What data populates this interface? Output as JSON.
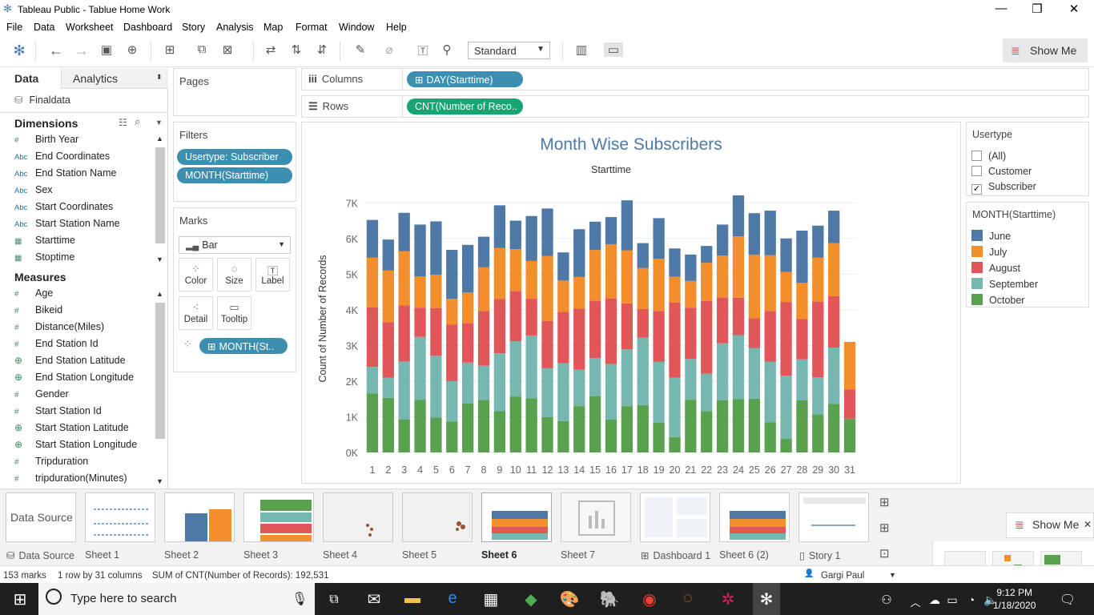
{
  "app": {
    "title": "Tableau Public - Tablue Home Work"
  },
  "menu": [
    "File",
    "Data",
    "Worksheet",
    "Dashboard",
    "Story",
    "Analysis",
    "Map",
    "Format",
    "Window",
    "Help"
  ],
  "toolbar": {
    "fit_value": "Standard",
    "show_me": "Show Me"
  },
  "data_pane": {
    "tab_data": "Data",
    "tab_analytics": "Analytics",
    "datasource": "Finaldata",
    "dimensions_header": "Dimensions",
    "dimensions": [
      {
        "type": "#",
        "name": "Birth Year"
      },
      {
        "type": "Abc",
        "name": "End Coordinates"
      },
      {
        "type": "Abc",
        "name": "End Station Name"
      },
      {
        "type": "Abc",
        "name": "Sex"
      },
      {
        "type": "Abc",
        "name": "Start Coordinates"
      },
      {
        "type": "Abc",
        "name": "Start Station Name"
      },
      {
        "type": "date",
        "name": "Starttime"
      },
      {
        "type": "date",
        "name": "Stoptime"
      }
    ],
    "measures_header": "Measures",
    "measures": [
      {
        "type": "#",
        "name": "Age"
      },
      {
        "type": "#",
        "name": "Bikeid"
      },
      {
        "type": "#",
        "name": "Distance(Miles)"
      },
      {
        "type": "#",
        "name": "End Station Id"
      },
      {
        "type": "geo",
        "name": "End Station Latitude"
      },
      {
        "type": "geo",
        "name": "End Station Longitude"
      },
      {
        "type": "#",
        "name": "Gender"
      },
      {
        "type": "#",
        "name": "Start Station Id"
      },
      {
        "type": "geo",
        "name": "Start Station Latitude"
      },
      {
        "type": "geo",
        "name": "Start Station Longitude"
      },
      {
        "type": "#",
        "name": "Tripduration"
      },
      {
        "type": "#",
        "name": "tripduration(Minutes)"
      }
    ]
  },
  "cards": {
    "pages": "Pages",
    "filters": "Filters",
    "filter_pills": [
      "Usertype: Subscriber",
      "MONTH(Starttime)"
    ],
    "marks": "Marks",
    "mark_type": "Bar",
    "mark_buttons": [
      "Color",
      "Size",
      "Label",
      "Detail",
      "Tooltip"
    ],
    "marks_pill": "MONTH(St.."
  },
  "shelves": {
    "columns_label": "Columns",
    "columns_pill": "DAY(Starttime)",
    "rows_label": "Rows",
    "rows_pill": "CNT(Number of Reco.."
  },
  "legends": {
    "usertype_title": "Usertype",
    "usertype_items": [
      {
        "label": "(All)",
        "checked": false
      },
      {
        "label": "Customer",
        "checked": false
      },
      {
        "label": "Subscriber",
        "checked": true
      }
    ],
    "month_title": "MONTH(Starttime)",
    "month_items": [
      {
        "label": "June",
        "color": "#4e79a7"
      },
      {
        "label": "July",
        "color": "#f28e2b"
      },
      {
        "label": "August",
        "color": "#e15759"
      },
      {
        "label": "September",
        "color": "#76b7b2"
      },
      {
        "label": "October",
        "color": "#59a14f"
      }
    ]
  },
  "chart_data": {
    "type": "bar",
    "stacked": true,
    "title": "Month Wise Subscribers",
    "xlabel": "Starttime",
    "ylabel": "Count of Number of Records",
    "ylim": [
      0,
      7500
    ],
    "yticks": [
      0,
      1000,
      2000,
      3000,
      4000,
      5000,
      6000,
      7000
    ],
    "ytick_labels": [
      "0K",
      "1K",
      "2K",
      "3K",
      "4K",
      "5K",
      "6K",
      "7K"
    ],
    "categories": [
      "1",
      "2",
      "3",
      "4",
      "5",
      "6",
      "7",
      "8",
      "9",
      "10",
      "11",
      "12",
      "13",
      "14",
      "15",
      "16",
      "17",
      "18",
      "19",
      "20",
      "21",
      "22",
      "23",
      "24",
      "25",
      "26",
      "27",
      "28",
      "29",
      "30",
      "31"
    ],
    "series": [
      {
        "name": "October",
        "color": "#59a14f",
        "values": [
          1650,
          1530,
          930,
          1480,
          980,
          870,
          1370,
          1470,
          1160,
          1570,
          1520,
          990,
          880,
          1300,
          1580,
          920,
          1300,
          1330,
          830,
          430,
          1480,
          1160,
          1460,
          1500,
          1510,
          850,
          380,
          1460,
          1070,
          1360,
          950
        ]
      },
      {
        "name": "September",
        "color": "#76b7b2",
        "values": [
          750,
          570,
          1620,
          1760,
          1730,
          1130,
          1150,
          960,
          1620,
          1550,
          1760,
          1370,
          1620,
          1020,
          1070,
          1560,
          1590,
          1890,
          1710,
          1670,
          1140,
          1050,
          1600,
          1790,
          1420,
          1690,
          1770,
          1150,
          1040,
          1580,
          0
        ]
      },
      {
        "name": "August",
        "color": "#e15759",
        "values": [
          1670,
          1550,
          1570,
          820,
          1340,
          1590,
          1110,
          1540,
          1520,
          1410,
          1030,
          1330,
          1440,
          1710,
          1610,
          1840,
          1290,
          800,
          1430,
          2100,
          1440,
          2040,
          1290,
          1050,
          830,
          1430,
          2070,
          1130,
          2120,
          1440,
          820
        ]
      },
      {
        "name": "July",
        "color": "#f28e2b",
        "values": [
          1390,
          1450,
          1520,
          880,
          930,
          720,
          860,
          1220,
          1430,
          1170,
          1060,
          1820,
          880,
          890,
          1420,
          1520,
          1490,
          1150,
          1460,
          730,
          750,
          1070,
          1170,
          1720,
          1780,
          1560,
          840,
          1020,
          1230,
          1490,
          1330
        ]
      },
      {
        "name": "June",
        "color": "#4e79a7",
        "values": [
          1060,
          870,
          1080,
          1450,
          1500,
          1370,
          1330,
          860,
          1200,
          800,
          1260,
          1330,
          790,
          1340,
          790,
          760,
          1400,
          700,
          1140,
          790,
          740,
          470,
          870,
          1150,
          1170,
          1250,
          940,
          1460,
          900,
          910,
          0
        ]
      }
    ]
  },
  "sheet_tabs": [
    "Data Source",
    "Sheet 1",
    "Sheet 2",
    "Sheet 3",
    "Sheet 4",
    "Sheet 5",
    "Sheet 6",
    "Sheet 7",
    "Dashboard 1",
    "Sheet 6 (2)",
    "Story 1"
  ],
  "active_sheet": "Sheet 6",
  "status": {
    "marks": "153 marks",
    "dims": "1 row by 31 columns",
    "sum": "SUM of CNT(Number of Records): 192,531",
    "user": "Gargi Paul"
  },
  "showme_popup": "Show Me",
  "taskbar": {
    "search_placeholder": "Type here to search",
    "time": "9:12 PM",
    "date": "1/18/2020"
  }
}
